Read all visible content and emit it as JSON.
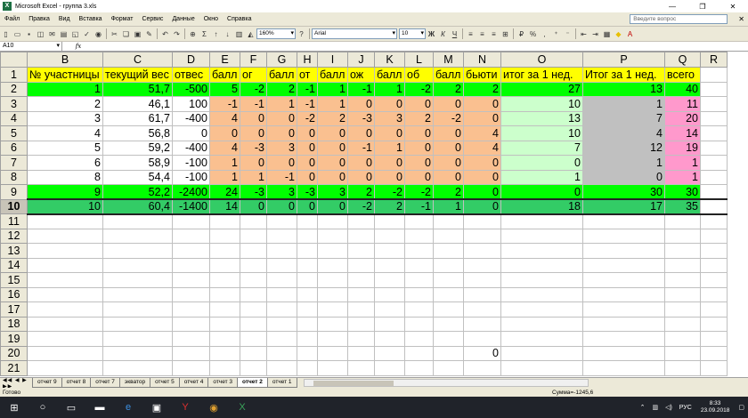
{
  "window": {
    "title": "Microsoft Excel - группа 3.xls",
    "app_icon": "X"
  },
  "menu": [
    "Файл",
    "Правка",
    "Вид",
    "Вставка",
    "Формат",
    "Сервис",
    "Данные",
    "Окно",
    "Справка"
  ],
  "help_placeholder": "Введите вопрос",
  "toolbar": {
    "zoom": "160%",
    "font": "Arial",
    "size": "10"
  },
  "formula_bar": {
    "name_box": "A10",
    "fx": "fx"
  },
  "columns": [
    "B",
    "C",
    "D",
    "E",
    "F",
    "G",
    "H",
    "I",
    "J",
    "K",
    "L",
    "M",
    "N",
    "O",
    "P",
    "Q",
    "R"
  ],
  "rows": [
    {
      "n": "1",
      "cells": [
        "№ участницы",
        "текущий вес",
        "отвес",
        "балл",
        "ог",
        "балл",
        "от",
        "балл",
        "ож",
        "балл",
        "об",
        "балл",
        "бьюти",
        "итог за 1 нед.",
        "Итог за 1 нед.",
        "всего",
        ""
      ]
    },
    {
      "n": "2",
      "cells": [
        "1",
        "51,7",
        "-500",
        "5",
        "-2",
        "2",
        "-1",
        "1",
        "-1",
        "1",
        "-2",
        "2",
        "2",
        "27",
        "13",
        "40",
        ""
      ]
    },
    {
      "n": "3",
      "cells": [
        "2",
        "46,1",
        "100",
        "-1",
        "-1",
        "1",
        "-1",
        "1",
        "0",
        "0",
        "0",
        "0",
        "0",
        "10",
        "1",
        "11",
        ""
      ]
    },
    {
      "n": "4",
      "cells": [
        "3",
        "61,7",
        "-400",
        "4",
        "0",
        "0",
        "-2",
        "2",
        "-3",
        "3",
        "2",
        "-2",
        "0",
        "13",
        "7",
        "20",
        ""
      ]
    },
    {
      "n": "5",
      "cells": [
        "4",
        "56,8",
        "0",
        "0",
        "0",
        "0",
        "0",
        "0",
        "0",
        "0",
        "0",
        "0",
        "4",
        "10",
        "4",
        "14",
        ""
      ]
    },
    {
      "n": "6",
      "cells": [
        "5",
        "59,2",
        "-400",
        "4",
        "-3",
        "3",
        "0",
        "0",
        "-1",
        "1",
        "0",
        "0",
        "4",
        "7",
        "12",
        "19",
        ""
      ]
    },
    {
      "n": "7",
      "cells": [
        "6",
        "58,9",
        "-100",
        "1",
        "0",
        "0",
        "0",
        "0",
        "0",
        "0",
        "0",
        "0",
        "0",
        "0",
        "1",
        "1",
        ""
      ]
    },
    {
      "n": "8",
      "cells": [
        "8",
        "54,4",
        "-100",
        "1",
        "1",
        "-1",
        "0",
        "0",
        "0",
        "0",
        "0",
        "0",
        "0",
        "1",
        "0",
        "1",
        ""
      ]
    },
    {
      "n": "9",
      "cells": [
        "9",
        "52,2",
        "-2400",
        "24",
        "-3",
        "3",
        "-3",
        "3",
        "2",
        "-2",
        "-2",
        "2",
        "0",
        "0",
        "30",
        "30",
        ""
      ]
    },
    {
      "n": "10",
      "cells": [
        "10",
        "60,4",
        "-1400",
        "14",
        "0",
        "0",
        "0",
        "0",
        "-2",
        "2",
        "-1",
        "1",
        "0",
        "18",
        "17",
        "35",
        ""
      ]
    },
    {
      "n": "11",
      "cells": []
    },
    {
      "n": "12",
      "cells": []
    },
    {
      "n": "13",
      "cells": []
    },
    {
      "n": "14",
      "cells": []
    },
    {
      "n": "15",
      "cells": []
    },
    {
      "n": "16",
      "cells": []
    },
    {
      "n": "17",
      "cells": []
    },
    {
      "n": "18",
      "cells": []
    },
    {
      "n": "19",
      "cells": []
    },
    {
      "n": "20",
      "cells": [
        "",
        "",
        "",
        "",
        "",
        "",
        "",
        "",
        "",
        "",
        "",
        "",
        "0",
        "",
        "",
        "",
        ""
      ]
    },
    {
      "n": "21",
      "cells": []
    }
  ],
  "colors": {
    "yellow": "#ffff00",
    "green": "#00ff00",
    "darkgreen": "#33cc66",
    "orange": "#fac090",
    "lightgreen": "#ccffcc",
    "gray": "#c0c0c0",
    "pink": "#ff99cc",
    "white": "#ffffff"
  },
  "tabs": [
    "отчет 9",
    "отчет 8",
    "отчет 7",
    "экватор",
    "отчет 5",
    "отчет 4",
    "отчет 3",
    "отчет 2",
    "отчет 1"
  ],
  "active_tab": "отчет 2",
  "status": {
    "ready": "Готово",
    "sum": "Сумма=-1245,6"
  },
  "tray": {
    "lang": "РУС",
    "time": "8:33",
    "date": "23.09.2018"
  }
}
